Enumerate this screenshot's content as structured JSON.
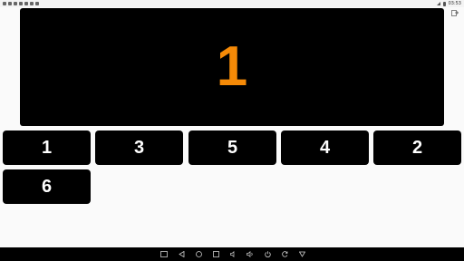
{
  "status_bar": {
    "time": "03:53"
  },
  "display": {
    "value": "1",
    "color": "#f58a07"
  },
  "buttons": [
    {
      "label": "1"
    },
    {
      "label": "3"
    },
    {
      "label": "5"
    },
    {
      "label": "4"
    },
    {
      "label": "2"
    },
    {
      "label": "6"
    }
  ],
  "nav_bar": {
    "icons": [
      "screenshot-icon",
      "back-icon",
      "home-icon",
      "recents-icon",
      "volume-down-icon",
      "volume-up-icon",
      "power-icon",
      "rotate-icon",
      "menu-icon"
    ]
  }
}
